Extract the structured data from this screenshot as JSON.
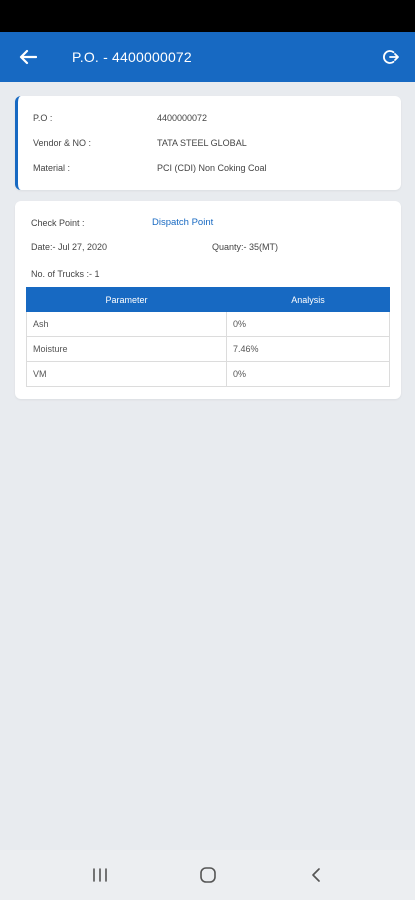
{
  "header": {
    "title": "P.O. - 4400000072",
    "back_icon": "arrow-left-icon",
    "logout_icon": "logout-icon",
    "color": "#1769c2"
  },
  "po_card": {
    "po_label": "P.O :",
    "po_value": "4400000072",
    "vendor_label": "Vendor & NO :",
    "vendor_value": "TATA STEEL GLOBAL",
    "material_label": "Material :",
    "material_value": "PCI (CDI) Non Coking Coal"
  },
  "detail_card": {
    "checkpoint_label": "Check Point :",
    "checkpoint_value": "Dispatch Point",
    "date_text": "Date:-  Jul 27, 2020",
    "quantity_text": "Quanty:- 35(MT)",
    "trucks_text": "No. of Trucks :- 1"
  },
  "analysis_table": {
    "columns": [
      "Parameter",
      "Analysis"
    ],
    "rows": [
      [
        "Ash",
        "0%"
      ],
      [
        "Moisture",
        "7.46%"
      ],
      [
        "VM",
        "0%"
      ]
    ]
  },
  "nav": {
    "recent_icon": "recent-apps-icon",
    "home_icon": "home-icon",
    "back_icon": "nav-back-icon"
  }
}
